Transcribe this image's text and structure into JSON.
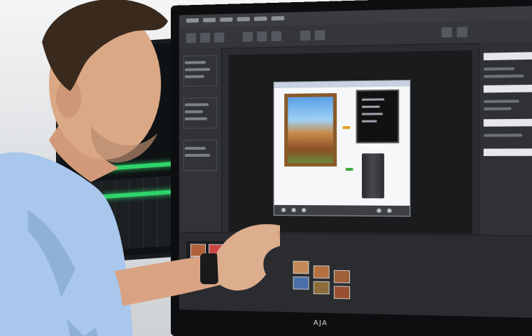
{
  "scene": {
    "description_label": "",
    "monitor_brand": "AJA"
  },
  "colors": {
    "waveform": "#2fd36a",
    "shirt": "#a9c6ec",
    "skin": "#d9a383",
    "hair": "#3a2a1e",
    "editor_bg": "#2b2d30"
  },
  "icons": [
    "desktop-monitor-icon",
    "tower-pc-icon"
  ]
}
